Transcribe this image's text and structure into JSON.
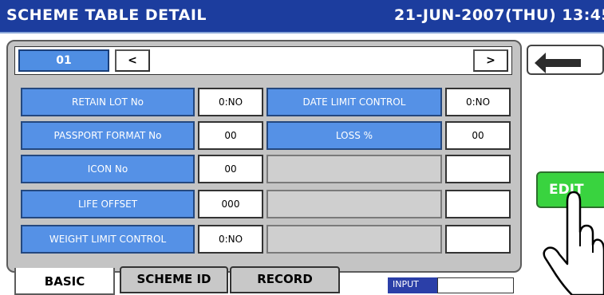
{
  "header": {
    "title": "SCHEME TABLE DETAIL",
    "datetime": "21-JUN-2007(THU) 13:45"
  },
  "nav": {
    "page": "01",
    "prev_label": "<",
    "next_label": ">"
  },
  "fields": {
    "retain_lot_label": "RETAIN LOT No",
    "retain_lot_value": "0:NO",
    "passport_format_label": "PASSPORT FORMAT No",
    "passport_format_value": "00",
    "icon_label": "ICON No",
    "icon_value": "00",
    "life_offset_label": "LIFE OFFSET",
    "life_offset_value": "000",
    "weight_limit_label": "WEIGHT LIMIT CONTROL",
    "weight_limit_value": "0:NO",
    "date_limit_label": "DATE LIMIT CONTROL",
    "date_limit_value": "0:NO",
    "loss_label": "LOSS %",
    "loss_value": "00"
  },
  "tabs": {
    "basic": "BASIC",
    "scheme_id": "SCHEME ID",
    "record": "RECORD"
  },
  "input": {
    "label": "INPUT",
    "value": ""
  },
  "buttons": {
    "edit": "EDIT",
    "back_icon": "return-arrow-icon"
  },
  "colors": {
    "title_bar": "#1c3d9e",
    "label_blue": "#5591e6",
    "edit_green": "#39d33f"
  }
}
